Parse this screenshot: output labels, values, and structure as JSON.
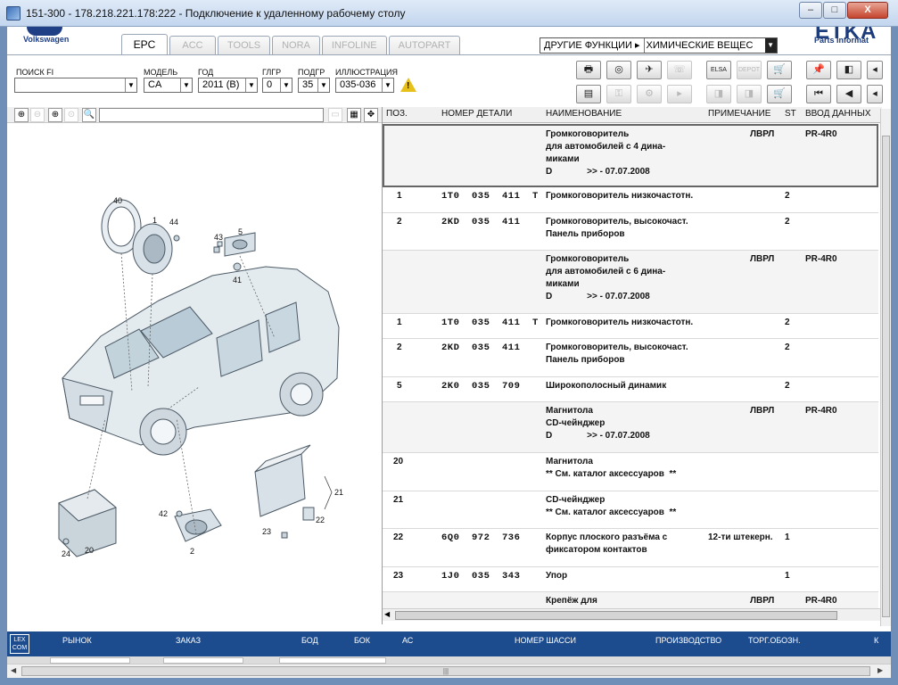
{
  "window": {
    "title": "151-300 - 178.218.221.178:222 - Подключение к удаленному рабочему столу",
    "minimize": "–",
    "maximize": "□",
    "close": "X"
  },
  "header": {
    "brand": "Volkswagen",
    "etka_logo": "ETKA",
    "etka_sub": "Parts Informat"
  },
  "tabs": [
    "EPC",
    "ACC",
    "TOOLS",
    "NORA",
    "INFOLINE",
    "AUTOPART"
  ],
  "functions": {
    "other_label": "ДРУГИЕ ФУНКЦИИ ▸",
    "select_value": "ХИМИЧЕСКИЕ ВЕЩЕС",
    "arrow": "▼"
  },
  "filters": {
    "search_label": "ПОИСК FI",
    "search_value": "",
    "model_label": "МОДЕЛЬ",
    "model_value": "CA",
    "year_label": "ГОД",
    "year_value": "2011 (B)",
    "group_label": "ГЛГР",
    "group_value": "0",
    "subgroup_label": "ПОДГР",
    "subgroup_value": "35",
    "illustration_label": "ИЛЛЮСТРАЦИЯ",
    "illustration_value": "035-036",
    "warning": "!",
    "arrow": "▼"
  },
  "toolbar": {
    "row1": [
      "🖶",
      "◎",
      "✈",
      "☏",
      "ELSA",
      "DEPOT",
      "🛒",
      "📌",
      "◧",
      "◂"
    ],
    "row2": [
      "▤",
      "⚿",
      "⚙",
      "▸",
      "◨",
      "◨",
      "🛒",
      "⏮",
      "◀",
      "◂"
    ]
  },
  "left_tools": [
    "⊕",
    "⊖",
    "⊕",
    "⊙",
    "🔍",
    "▭",
    "▦",
    "✥"
  ],
  "callouts": [
    "40",
    "1",
    "44",
    "43",
    "5",
    "41",
    "42",
    "2",
    "23",
    "22",
    "21",
    "24",
    "20"
  ],
  "table": {
    "headers": {
      "pos": "ПОЗ.",
      "part": "НОМЕР ДЕТАЛИ",
      "name": "НАИМЕНОВАНИЕ",
      "note": "ПРИМЕЧАНИЕ",
      "st": "ST",
      "input": "ВВОД ДАННЫХ"
    },
    "rows": [
      {
        "pos": "",
        "part": "",
        "name": "Громкоговоритель\nдля автомобилей с 4 дина-\nмиками\nD              >> - 07.07.2008",
        "note": "ЛВРЛ",
        "st": "",
        "input": "PR-4R0"
      },
      {
        "pos": "1",
        "part": "1T0  035  411  T",
        "name": "Громкоговоритель низкочастотн.",
        "note": "",
        "st": "2",
        "input": ""
      },
      {
        "pos": "2",
        "part": "2KD  035  411",
        "name": "Громкоговоритель, высокочаст.\nПанель приборов",
        "note": "",
        "st": "2",
        "input": ""
      },
      {
        "pos": "",
        "part": "",
        "name": "Громкоговоритель\nдля автомобилей с 6 дина-\nмиками\nD              >> - 07.07.2008",
        "note": "ЛВРЛ",
        "st": "",
        "input": "PR-4R0"
      },
      {
        "pos": "1",
        "part": "1T0  035  411  T",
        "name": "Громкоговоритель низкочастотн.",
        "note": "",
        "st": "2",
        "input": ""
      },
      {
        "pos": "2",
        "part": "2KD  035  411",
        "name": "Громкоговоритель, высокочаст.\nПанель приборов",
        "note": "",
        "st": "2",
        "input": ""
      },
      {
        "pos": "5",
        "part": "2K0  035  709",
        "name": "Широкополосный динамик",
        "note": "",
        "st": "2",
        "input": ""
      },
      {
        "pos": "",
        "part": "",
        "name": "Магнитола\nCD-чейнджер\nD              >> - 07.07.2008",
        "note": "ЛВРЛ",
        "st": "",
        "input": "PR-4R0"
      },
      {
        "pos": "20",
        "part": "",
        "name": "Магнитола\n** См. каталог аксессуаров  **",
        "note": "",
        "st": "",
        "input": ""
      },
      {
        "pos": "21",
        "part": "",
        "name": "CD-чейнджер\n** См. каталог аксессуаров  **",
        "note": "",
        "st": "",
        "input": ""
      },
      {
        "pos": "22",
        "part": "6Q0  972  736",
        "name": "Корпус плоского разъёма с\nфиксатором контактов",
        "note": "12-ти штекерн.",
        "st": "1",
        "input": ""
      },
      {
        "pos": "23",
        "part": "1J0  035  343",
        "name": "Упор",
        "note": "",
        "st": "1",
        "input": ""
      },
      {
        "pos": "",
        "part": "",
        "name": "Крепёж для",
        "note": "ЛВРЛ",
        "st": "",
        "input": "PR-4R0"
      }
    ]
  },
  "statusbar": {
    "logo": "LEX\nCOM",
    "items": [
      "РЫНОК",
      "ЗАКАЗ",
      "БОД",
      "БОК",
      "АС",
      "НОМЕР ШАССИ",
      "ПРОИЗВОДСТВО",
      "ТОРГ.ОБОЗН.",
      "К"
    ]
  },
  "colors": {
    "statusbar": "#1c4b8e",
    "brand": "#1e3f85",
    "warning": "#e8c01a"
  }
}
